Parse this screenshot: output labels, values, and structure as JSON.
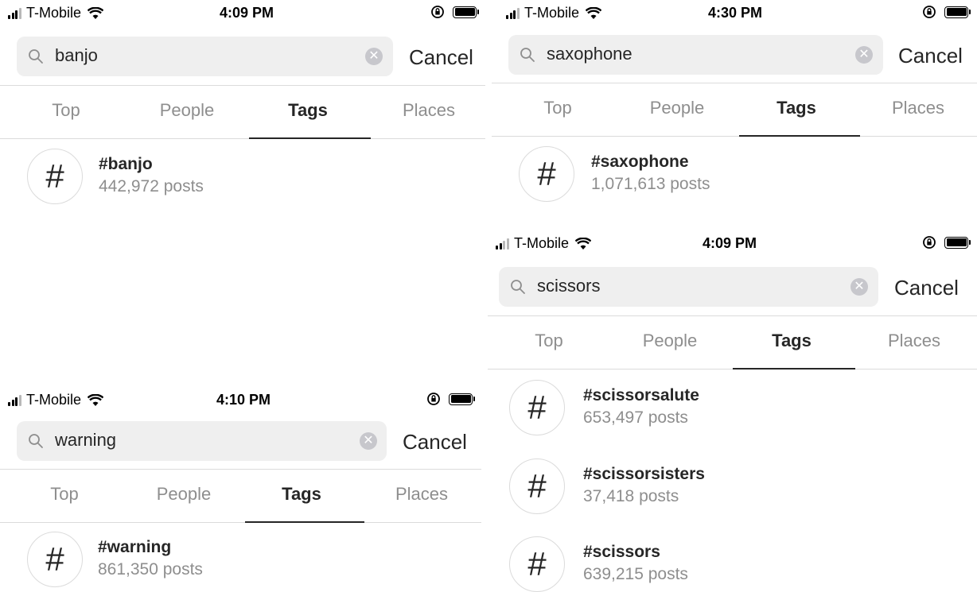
{
  "panels": [
    {
      "status": {
        "carrier": "T-Mobile",
        "time": "4:09 PM"
      },
      "search": {
        "query": "banjo",
        "cancel_label": "Cancel"
      },
      "tabs": [
        "Top",
        "People",
        "Tags",
        "Places"
      ],
      "active_tab": "Tags",
      "results": [
        {
          "tag": "#banjo",
          "count": "442,972 posts"
        }
      ]
    },
    {
      "status": {
        "carrier": "T-Mobile",
        "time": "4:30 PM"
      },
      "search": {
        "query": "saxophone",
        "cancel_label": "Cancel"
      },
      "tabs": [
        "Top",
        "People",
        "Tags",
        "Places"
      ],
      "active_tab": "Tags",
      "results": [
        {
          "tag": "#saxophone",
          "count": "1,071,613 posts"
        }
      ]
    },
    {
      "status": {
        "carrier": "T-Mobile",
        "time": "4:10 PM"
      },
      "search": {
        "query": "warning",
        "cancel_label": "Cancel"
      },
      "tabs": [
        "Top",
        "People",
        "Tags",
        "Places"
      ],
      "active_tab": "Tags",
      "results": [
        {
          "tag": "#warning",
          "count": "861,350 posts"
        }
      ]
    },
    {
      "status": {
        "carrier": "T-Mobile",
        "time": "4:09 PM"
      },
      "search": {
        "query": "scissors",
        "cancel_label": "Cancel"
      },
      "tabs": [
        "Top",
        "People",
        "Tags",
        "Places"
      ],
      "active_tab": "Tags",
      "results": [
        {
          "tag": "#scissorsalute",
          "count": "653,497 posts"
        },
        {
          "tag": "#scissorsisters",
          "count": "37,418 posts"
        },
        {
          "tag": "#scissors",
          "count": "639,215 posts"
        }
      ]
    }
  ],
  "icons": {
    "signal": "cellular-signal-icon",
    "wifi": "wifi-icon",
    "rotation_lock": "rotation-lock-icon",
    "battery": "battery-icon",
    "search": "search-icon",
    "clear": "clear-icon",
    "hashtag": "hashtag-icon"
  },
  "colors": {
    "text": "#262626",
    "secondary": "#8e8e8e",
    "searchbar_bg": "#efefef",
    "divider": "#dbdbdb"
  }
}
